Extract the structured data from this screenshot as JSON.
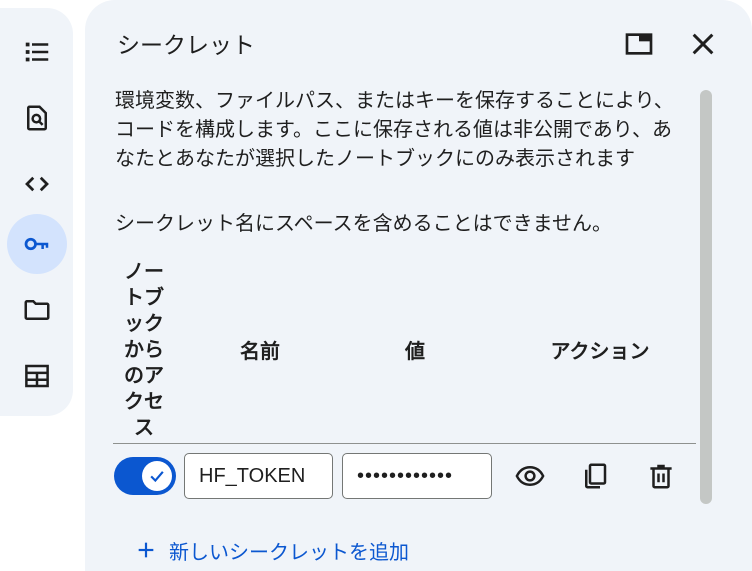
{
  "rail": {
    "items": [
      {
        "icon": "list-icon",
        "active": false
      },
      {
        "icon": "search-doc-icon",
        "active": false
      },
      {
        "icon": "code-icon",
        "active": false
      },
      {
        "icon": "key-icon",
        "active": true
      },
      {
        "icon": "folder-icon",
        "active": false
      },
      {
        "icon": "table-icon",
        "active": false
      }
    ]
  },
  "panel": {
    "title": "シークレット",
    "description": "環境変数、ファイルパス、またはキーを保存することにより、コードを構成します。ここに保存される値は非公開であり、あなたとあなたが選択したノートブックにのみ表示されます",
    "warning": "シークレット名にスペースを含めることはできません。",
    "columns": {
      "access": "ノートブックからのアクセス",
      "name": "名前",
      "value": "値",
      "actions": "アクション"
    },
    "secrets": [
      {
        "enabled": true,
        "name": "HF_TOKEN",
        "value_masked": "••••••••••••"
      }
    ],
    "add_label": "新しいシークレットを追加"
  },
  "colors": {
    "accent": "#0b57d0",
    "panel_bg": "#f0f4f9",
    "active_rail": "#d3e3fd"
  }
}
